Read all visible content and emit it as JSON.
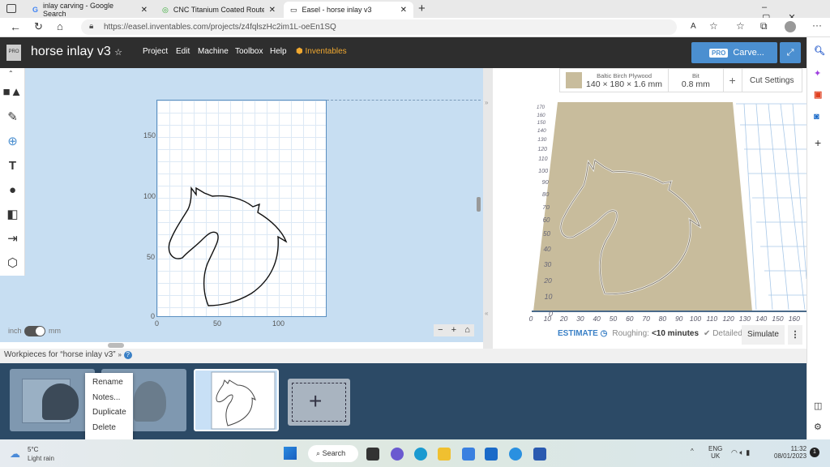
{
  "browser": {
    "tabs": [
      {
        "label": "inlay carving - Google Search"
      },
      {
        "label": "CNC Titanium Coated Router Bits"
      },
      {
        "label": "Easel - horse inlay v3",
        "active": true
      }
    ],
    "url": "https://easel.inventables.com/projects/z4fqlszHc2im1L-oeEn1SQ"
  },
  "app": {
    "title": "horse inlay v3",
    "logo_badge": "PRO",
    "menu": [
      "Project",
      "Edit",
      "Machine",
      "Toolbox",
      "Help"
    ],
    "brand": "Inventables",
    "carve_badge": "PRO",
    "carve_label": "Carve...",
    "accent": "#4b8fd0"
  },
  "canvas": {
    "y_ticks": [
      "150",
      "100",
      "50",
      "0"
    ],
    "x_ticks": [
      "0",
      "50",
      "100"
    ],
    "unit_left": "inch",
    "unit_right": "mm",
    "unit_selected": "mm"
  },
  "material": {
    "name": "Baltic Birch Plywood",
    "dims": "140 × 180 × 1.6 mm",
    "bit_label": "Bit",
    "bit": "0.8 mm",
    "add": "+",
    "cut_settings": "Cut Settings"
  },
  "preview": {
    "y_ticks": [
      "170",
      "160",
      "150",
      "140",
      "130",
      "120",
      "110",
      "100",
      "90",
      "80",
      "70",
      "60",
      "50",
      "40",
      "30",
      "20",
      "10",
      "0"
    ],
    "x_ticks": [
      "0",
      "10",
      "20",
      "30",
      "40",
      "50",
      "60",
      "70",
      "80",
      "90",
      "100",
      "110",
      "120",
      "130",
      "140",
      "150",
      "160"
    ]
  },
  "estimate": {
    "label": "ESTIMATE",
    "roughing_label": "Roughing:",
    "roughing_value": "<10 minutes",
    "detailed": "Detailed",
    "simulate": "Simulate"
  },
  "workpieces": {
    "title": "Workpieces for “horse inlay v3”",
    "context_menu": [
      "Rename",
      "Notes...",
      "Duplicate",
      "Delete"
    ]
  },
  "taskbar": {
    "temp": "5°C",
    "weather": "Light rain",
    "search": "Search",
    "lang1": "ENG",
    "lang2": "UK",
    "time": "11:32",
    "date": "08/01/2023",
    "notif": "1"
  }
}
